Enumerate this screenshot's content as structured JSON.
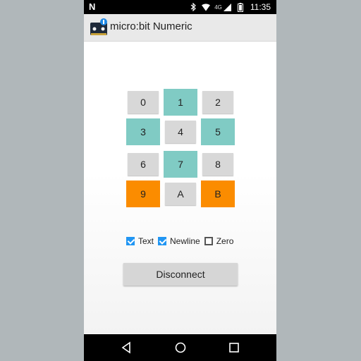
{
  "status_bar": {
    "left_label": "N",
    "network": "4G",
    "time": "11:35",
    "icons": [
      "bluetooth-icon",
      "wifi-icon",
      "signal-icon",
      "battery-icon"
    ]
  },
  "app_bar": {
    "title": "micro:bit Numeric",
    "icon": "microbit-app-icon"
  },
  "keypad": {
    "keys": [
      {
        "label": "0",
        "color": "grey"
      },
      {
        "label": "1",
        "color": "teal"
      },
      {
        "label": "2",
        "color": "grey"
      },
      {
        "label": "3",
        "color": "teal"
      },
      {
        "label": "4",
        "color": "grey"
      },
      {
        "label": "5",
        "color": "teal"
      },
      {
        "label": "6",
        "color": "grey"
      },
      {
        "label": "7",
        "color": "teal"
      },
      {
        "label": "8",
        "color": "grey"
      },
      {
        "label": "9",
        "color": "orange"
      },
      {
        "label": "A",
        "color": "grey"
      },
      {
        "label": "B",
        "color": "orange"
      }
    ],
    "colors": {
      "grey": "#d8d8d8",
      "teal": "#80cbc4",
      "orange": "#fb8c00"
    }
  },
  "options": [
    {
      "label": "Text",
      "checked": true
    },
    {
      "label": "Newline",
      "checked": true
    },
    {
      "label": "Zero",
      "checked": false
    }
  ],
  "disconnect_label": "Disconnect",
  "nav_bar": {
    "icons": [
      "back-icon",
      "home-icon",
      "recents-icon"
    ]
  },
  "accent_color": "#2196f3"
}
